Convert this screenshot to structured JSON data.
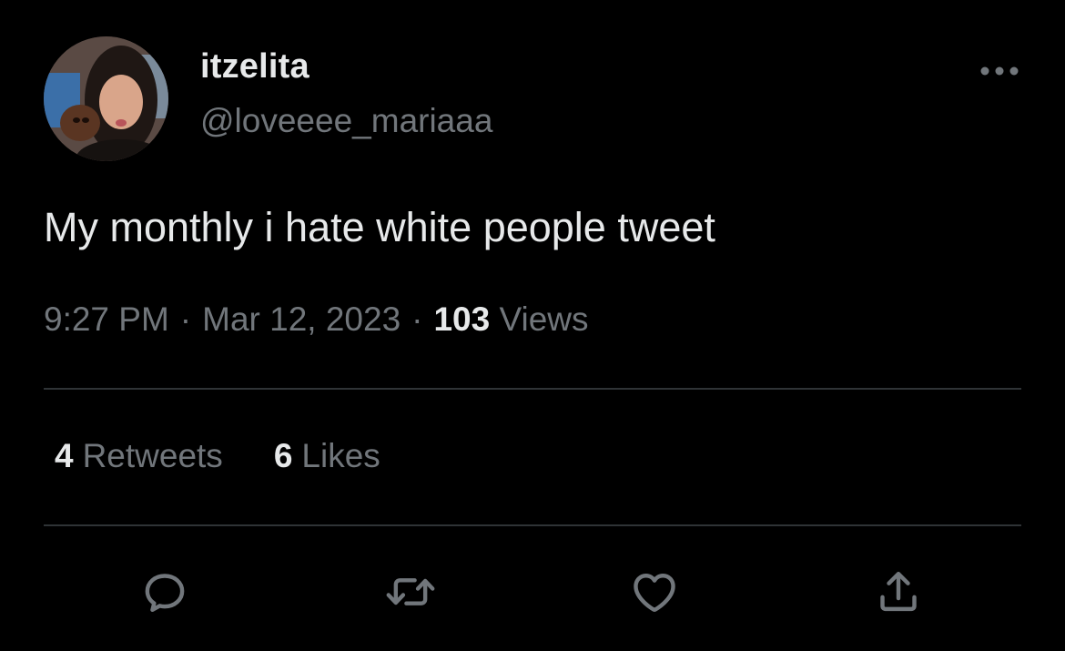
{
  "author": {
    "display_name": "itzelita",
    "handle": "@loveeee_mariaaa"
  },
  "tweet": {
    "text": "My monthly i hate white people tweet",
    "time": "9:27 PM",
    "separator": "·",
    "date": "Mar 12, 2023",
    "views_count": "103",
    "views_label": "Views"
  },
  "stats": {
    "retweets_count": "4",
    "retweets_label": "Retweets",
    "likes_count": "6",
    "likes_label": "Likes"
  },
  "icons": {
    "more": "more-horizontal-icon",
    "reply": "reply-icon",
    "retweet": "retweet-icon",
    "like": "heart-icon",
    "share": "share-icon"
  },
  "colors": {
    "background": "#000000",
    "primary_text": "#e7e9ea",
    "secondary_text": "#71767b",
    "divider": "#2f3336"
  }
}
